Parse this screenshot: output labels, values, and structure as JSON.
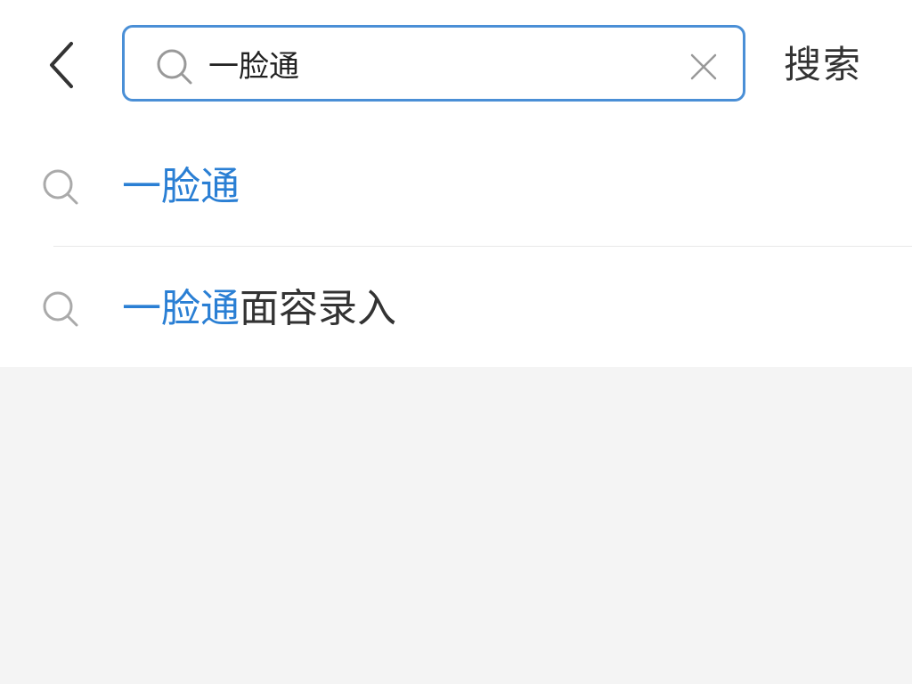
{
  "header": {
    "search_query": "一脸通",
    "search_button_label": "搜索",
    "border_color": "#4a8fd6"
  },
  "suggestions": [
    {
      "highlight": "一脸通",
      "rest": ""
    },
    {
      "highlight": "一脸通",
      "rest": "面容录入"
    }
  ],
  "colors": {
    "highlight": "#2a7fd4",
    "text": "#333333",
    "background": "#f4f4f4"
  },
  "icons": {
    "back": "chevron-left-icon",
    "search": "search-icon",
    "clear": "close-icon"
  }
}
